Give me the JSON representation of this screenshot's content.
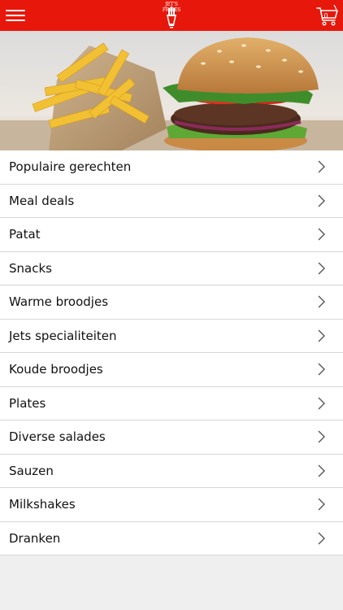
{
  "header": {
    "background": "#e8170b",
    "menu_icon": "hamburger-menu-icon",
    "logo_text": "JET'S FRITES",
    "cart_icon": "shopping-cart-icon",
    "cart_count": "0"
  },
  "hero": {
    "image": "burger-and-fries-photo"
  },
  "categories": [
    {
      "label": "Populaire gerechten"
    },
    {
      "label": "Meal deals"
    },
    {
      "label": "Patat"
    },
    {
      "label": "Snacks"
    },
    {
      "label": "Warme broodjes"
    },
    {
      "label": "Jets specialiteiten"
    },
    {
      "label": "Koude broodjes"
    },
    {
      "label": "Plates"
    },
    {
      "label": "Diverse salades"
    },
    {
      "label": "Sauzen"
    },
    {
      "label": "Milkshakes"
    },
    {
      "label": "Dranken"
    }
  ]
}
